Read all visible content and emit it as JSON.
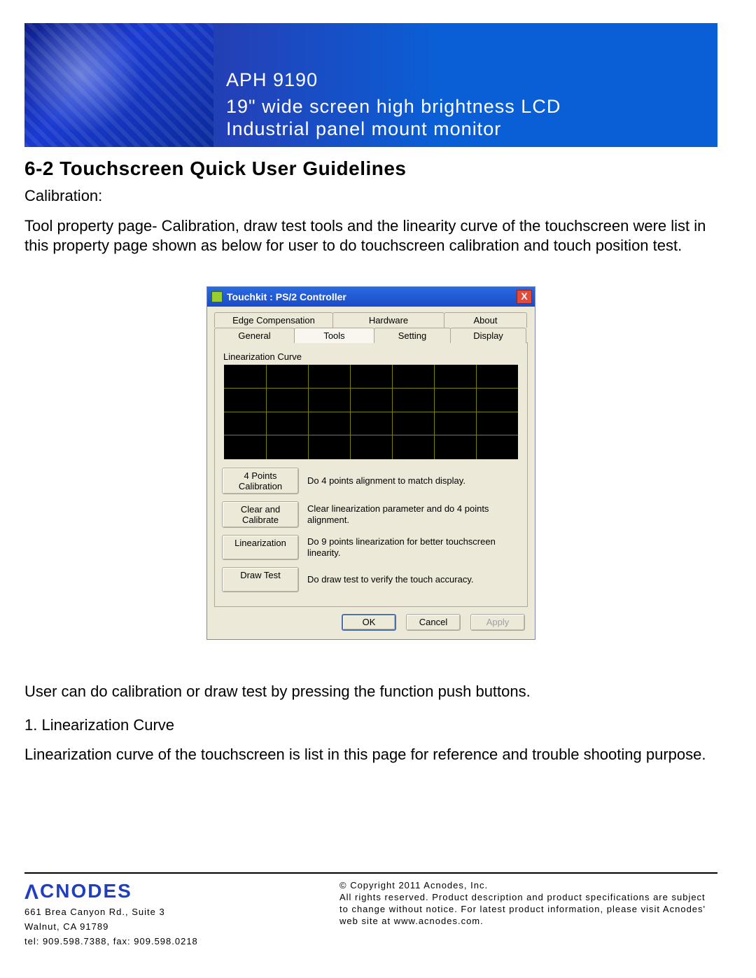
{
  "banner": {
    "model": "APH 9190",
    "line1": "19\" wide screen high brightness LCD",
    "line2": "Industrial panel mount monitor"
  },
  "section": {
    "title": "6-2  Touchscreen Quick User Guidelines",
    "calibration_label": "Calibration:",
    "para1": "Tool property page- Calibration, draw test tools and the linearity curve of the touchscreen were list in this property page shown as below for user to do touchscreen calibration and touch position test.",
    "para2": "User can do calibration or draw test by pressing the function push buttons.",
    "list1": "1. Linearization Curve",
    "para3": "Linearization curve of the touchscreen is list in this page for reference and trouble shooting purpose."
  },
  "dialog": {
    "title": "Touchkit : PS/2 Controller",
    "close": "X",
    "tabs_row1": [
      "Edge Compensation",
      "Hardware",
      "About"
    ],
    "tabs_row2": [
      "General",
      "Tools",
      "Setting",
      "Display"
    ],
    "group_label": "Linearization Curve",
    "tools": [
      {
        "label": "4 Points Calibration",
        "desc": "Do 4 points alignment to match display."
      },
      {
        "label": "Clear and Calibrate",
        "desc": "Clear linearization parameter and do 4 points alignment."
      },
      {
        "label": "Linearization",
        "desc": "Do 9 points linearization for better touchscreen linearity."
      },
      {
        "label": "Draw Test",
        "desc": "Do draw test to verify the touch accuracy."
      }
    ],
    "buttons": {
      "ok": "OK",
      "cancel": "Cancel",
      "apply": "Apply"
    }
  },
  "footer": {
    "brand": "CNODES",
    "addr1": "661 Brea Canyon Rd., Suite 3",
    "addr2": "Walnut, CA 91789",
    "addr3": "tel: 909.598.7388, fax: 909.598.0218",
    "copy1": "© Copyright 2011 Acnodes, Inc.",
    "copy2": "All rights reserved. Product description and product specifications are subject to change without notice. For latest product information, please visit Acnodes' web site at www.acnodes.com."
  }
}
